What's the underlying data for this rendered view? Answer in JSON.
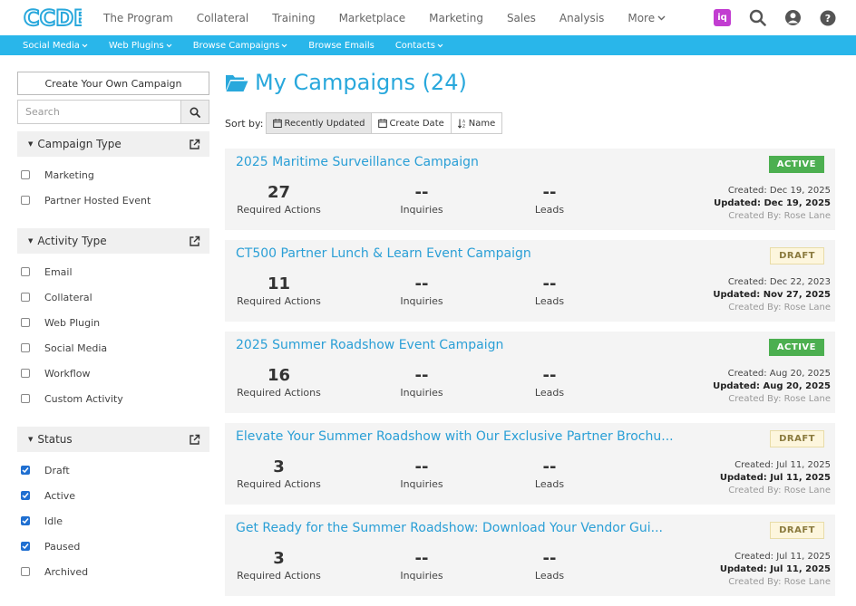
{
  "logo": {
    "text": "CCDE"
  },
  "topnav": {
    "items": [
      "The Program",
      "Collateral",
      "Training",
      "Marketplace",
      "Marketing",
      "Sales",
      "Analysis"
    ],
    "more_label": "More",
    "iq_label": "iq"
  },
  "subnav": {
    "items": [
      "Social Media",
      "Web Plugins",
      "Browse Campaigns",
      "Browse Emails",
      "Contacts"
    ]
  },
  "sidebar": {
    "create_label": "Create Your Own Campaign",
    "search_placeholder": "Search",
    "campaign_type": {
      "title": "Campaign Type",
      "items": [
        {
          "label": "Marketing",
          "checked": false
        },
        {
          "label": "Partner Hosted Event",
          "checked": false
        }
      ]
    },
    "activity_type": {
      "title": "Activity Type",
      "items": [
        {
          "label": "Email",
          "checked": false
        },
        {
          "label": "Collateral",
          "checked": false
        },
        {
          "label": "Web Plugin",
          "checked": false
        },
        {
          "label": "Social Media",
          "checked": false
        },
        {
          "label": "Workflow",
          "checked": false
        },
        {
          "label": "Custom Activity",
          "checked": false
        }
      ]
    },
    "status": {
      "title": "Status",
      "items": [
        {
          "label": "Draft",
          "checked": true
        },
        {
          "label": "Active",
          "checked": true
        },
        {
          "label": "Idle",
          "checked": true
        },
        {
          "label": "Paused",
          "checked": true
        },
        {
          "label": "Archived",
          "checked": false
        }
      ]
    }
  },
  "main": {
    "title": "My Campaigns (24)",
    "sort_label": "Sort by:",
    "sort_options": [
      "Recently Updated",
      "Create Date",
      "Name"
    ],
    "metric_labels": {
      "actions": "Required Actions",
      "inquiries": "Inquiries",
      "leads": "Leads"
    },
    "campaigns": [
      {
        "name": "2025 Maritime Surveillance Campaign",
        "status": "ACTIVE",
        "required_actions": "27",
        "inquiries": "--",
        "leads": "--",
        "created": "Created: Dec 19, 2025",
        "updated": "Updated: Dec 19, 2025",
        "created_by": "Created By: Rose Lane"
      },
      {
        "name": "CT500 Partner Lunch & Learn Event Campaign",
        "status": "DRAFT",
        "required_actions": "11",
        "inquiries": "--",
        "leads": "--",
        "created": "Created: Dec 22, 2023",
        "updated": "Updated: Nov 27, 2025",
        "created_by": "Created By: Rose Lane"
      },
      {
        "name": "2025 Summer Roadshow Event Campaign",
        "status": "ACTIVE",
        "required_actions": "16",
        "inquiries": "--",
        "leads": "--",
        "created": "Created: Aug 20, 2025",
        "updated": "Updated: Aug 20, 2025",
        "created_by": "Created By: Rose Lane"
      },
      {
        "name": "Elevate Your Summer Roadshow with Our Exclusive Partner Brochu...",
        "status": "DRAFT",
        "required_actions": "3",
        "inquiries": "--",
        "leads": "--",
        "created": "Created: Jul 11, 2025",
        "updated": "Updated: Jul 11, 2025",
        "created_by": "Created By: Rose Lane"
      },
      {
        "name": "Get Ready for the Summer Roadshow: Download Your Vendor Gui...",
        "status": "DRAFT",
        "required_actions": "3",
        "inquiries": "--",
        "leads": "--",
        "created": "Created: Jul 11, 2025",
        "updated": "Updated: Jul 11, 2025",
        "created_by": "Created By: Rose Lane"
      }
    ]
  },
  "colors": {
    "brand_blue": "#29b6ea",
    "title_blue": "#29a8dc",
    "active_green": "#4caf50",
    "draft_bg": "#fdf6dd",
    "iq_purple": "#c23dd1",
    "checkbox_blue": "#1f6fd1"
  },
  "icons": {
    "search": "search-icon",
    "user": "user-icon",
    "help": "help-icon",
    "folder": "folder-open-icon",
    "external": "external-link-icon",
    "calendar": "calendar-icon",
    "sort_alpha": "sort-alpha-icon"
  }
}
